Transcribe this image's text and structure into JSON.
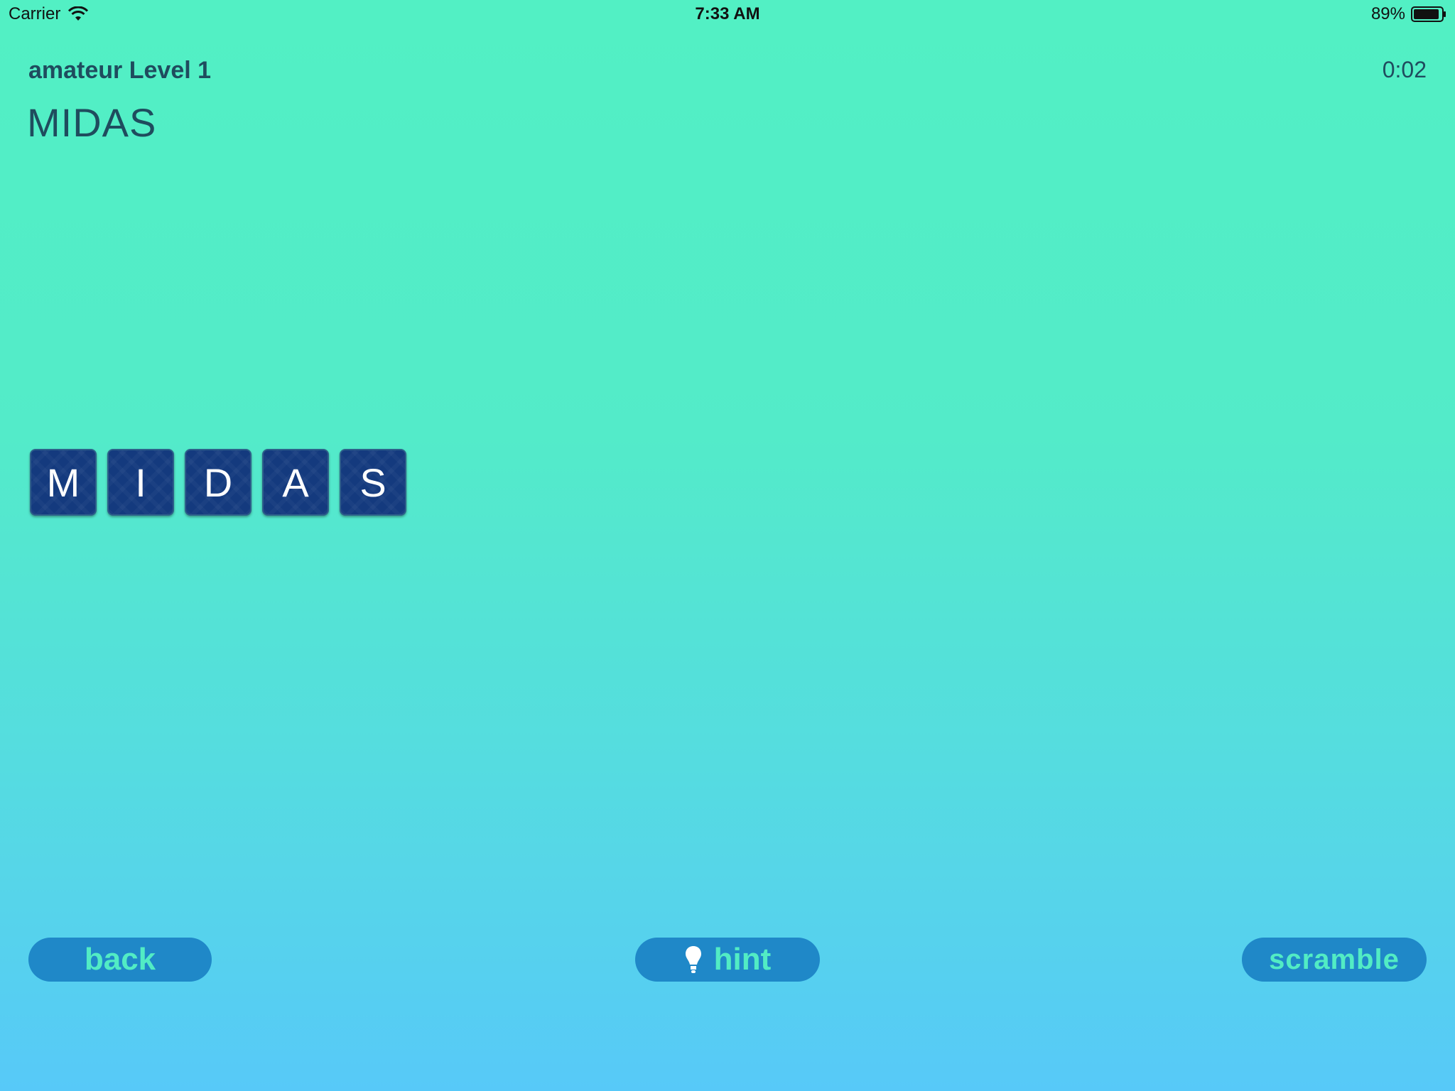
{
  "status_bar": {
    "carrier": "Carrier",
    "time": "7:33 AM",
    "battery": "89%"
  },
  "game": {
    "level_title": "amateur Level 1",
    "timer": "0:02",
    "target_word": "MIDAS",
    "tiles": [
      "M",
      "I",
      "D",
      "A",
      "S"
    ]
  },
  "buttons": {
    "back": "back",
    "hint": "hint",
    "scramble": "scramble"
  },
  "icons": {
    "wifi": "wifi-icon",
    "battery": "battery-icon",
    "hint": "lightbulb-icon"
  },
  "colors": {
    "background_top": "#52f0c4",
    "background_bottom": "#57c9f8",
    "tile": "#143a7e",
    "button": "#1f88c8",
    "button_text": "#52ecc4",
    "header_text": "#1f4c5e"
  }
}
